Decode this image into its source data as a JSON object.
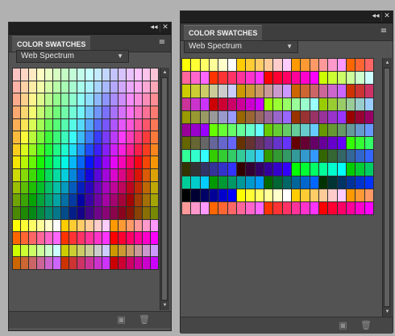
{
  "panels": [
    {
      "title_buttons": {
        "collapse": "◂◂",
        "close": "✕"
      },
      "tab_label": "COLOR SWATCHES",
      "menu_icon": "≡",
      "dropdown_value": "Web Spectrum",
      "dropdown_arrow": "▼",
      "scroll": {
        "up": "▲",
        "down": "▼"
      },
      "bottom_icons": {
        "new_swatch": "▣",
        "delete": "🗑"
      }
    },
    {
      "title_buttons": {
        "collapse": "◂◂",
        "close": "✕"
      },
      "tab_label": "COLOR SWATCHES",
      "menu_icon": "≡",
      "dropdown_value": "Web Spectrum",
      "dropdown_arrow": "▼",
      "scroll": {
        "up": "▲",
        "down": "▼"
      },
      "bottom_icons": {
        "new_swatch": "▣",
        "delete": "🗑"
      }
    }
  ],
  "swatch_counts": {
    "left_grid_cols": 18,
    "right_grid_cols": 21
  },
  "colors": {
    "panel_bg": "#535353",
    "titlebar": "#1f1f1f",
    "desktop": "#b1b1b1"
  }
}
